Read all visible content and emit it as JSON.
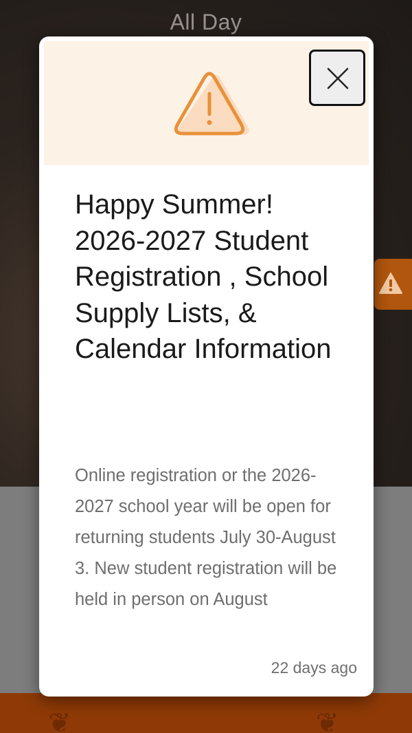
{
  "background": {
    "hero_title": "All Day"
  },
  "alert": {
    "icon": "warning-icon",
    "accent_color": "#e8913a",
    "header_bg": "#fdf2e6",
    "close_icon": "close-icon",
    "title": "Happy Summer! 2026-2027 Student Registration , School Supply Lists, & Calendar Information",
    "body": "Online registration or the 2026-2027 school year will be open for returning students July 30-August 3. New student registration will be held in person on August",
    "timestamp": "22 days ago"
  },
  "side_tab": {
    "icon": "warning-icon",
    "color": "#b1560e"
  },
  "footer": {
    "color": "#8f3a06"
  }
}
